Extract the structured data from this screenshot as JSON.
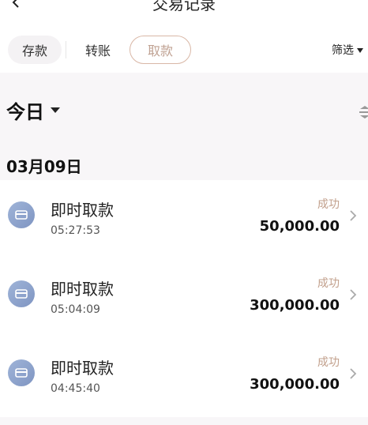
{
  "header": {
    "title": "交易记录"
  },
  "tabs": [
    {
      "label": "存款"
    },
    {
      "label": "转账"
    },
    {
      "label": "取款"
    }
  ],
  "filter": {
    "label": "筛选"
  },
  "period": {
    "label": "今日"
  },
  "date_group": {
    "label": "03月09日"
  },
  "transactions": [
    {
      "name": "即时取款",
      "time": "05:27:53",
      "status": "成功",
      "amount": "50,000.00"
    },
    {
      "name": "即时取款",
      "time": "05:04:09",
      "status": "成功",
      "amount": "300,000.00"
    },
    {
      "name": "即时取款",
      "time": "04:45:40",
      "status": "成功",
      "amount": "300,000.00"
    }
  ],
  "colors": {
    "accent": "#c0a293",
    "status_success": "#c2a08c",
    "icon_gradient_start": "#9fb4d8",
    "icon_gradient_end": "#7f95c2",
    "content_bg": "#f8f6f8"
  }
}
